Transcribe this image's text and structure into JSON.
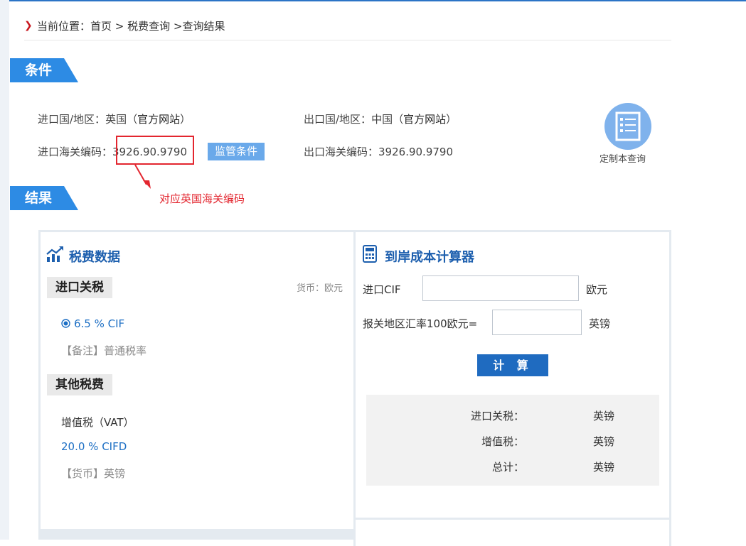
{
  "breadcrumb": {
    "prefix": "当前位置：",
    "home": "首页",
    "sep1": " > ",
    "query": "税费查询",
    "sep2": " >",
    "current": "查询结果"
  },
  "sections": {
    "condition": "条件",
    "result": "结果"
  },
  "conditions": {
    "import_country_label": "进口国/地区：",
    "import_country": "英国",
    "import_site_link": "官方网站",
    "export_country_label": "出口国/地区：",
    "export_country": "中国",
    "export_site_link": "官方网站",
    "import_code_label": "进口海关编码：",
    "import_code": "3926.90.9790",
    "export_code_label": "出口海关编码：",
    "export_code": "3926.90.9790",
    "supervise_button": "监管条件",
    "annotation": "对应英国海关编码",
    "custom_query_label": "定制本查询"
  },
  "tax_panel": {
    "title": "税费数据",
    "import_duty_tag": "进口关税",
    "currency_note": "货币：欧元",
    "duty_rate": "6.5 % CIF",
    "duty_remark": "【备注】普通税率",
    "other_tag": "其他税费",
    "vat_name": "增值税（VAT）",
    "vat_rate": "20.0 % CIFD",
    "vat_currency": "【货币】英镑"
  },
  "calculator": {
    "title": "到岸成本计算器",
    "cif_label": "进口CIF",
    "cif_value": "",
    "cif_unit": "欧元",
    "rate_label": "报关地区汇率100欧元=",
    "rate_value": "",
    "rate_unit": "英镑",
    "calc_button": "计 算",
    "results": [
      {
        "label": "进口关税：",
        "unit": "英镑"
      },
      {
        "label": "增值税：",
        "unit": "英镑"
      },
      {
        "label": "总计：",
        "unit": "英镑"
      }
    ]
  },
  "colors": {
    "accent": "#2d8be4",
    "link_blue": "#1d6fc4",
    "highlight_red": "#e3262f",
    "title_blue": "#1d5fae"
  }
}
